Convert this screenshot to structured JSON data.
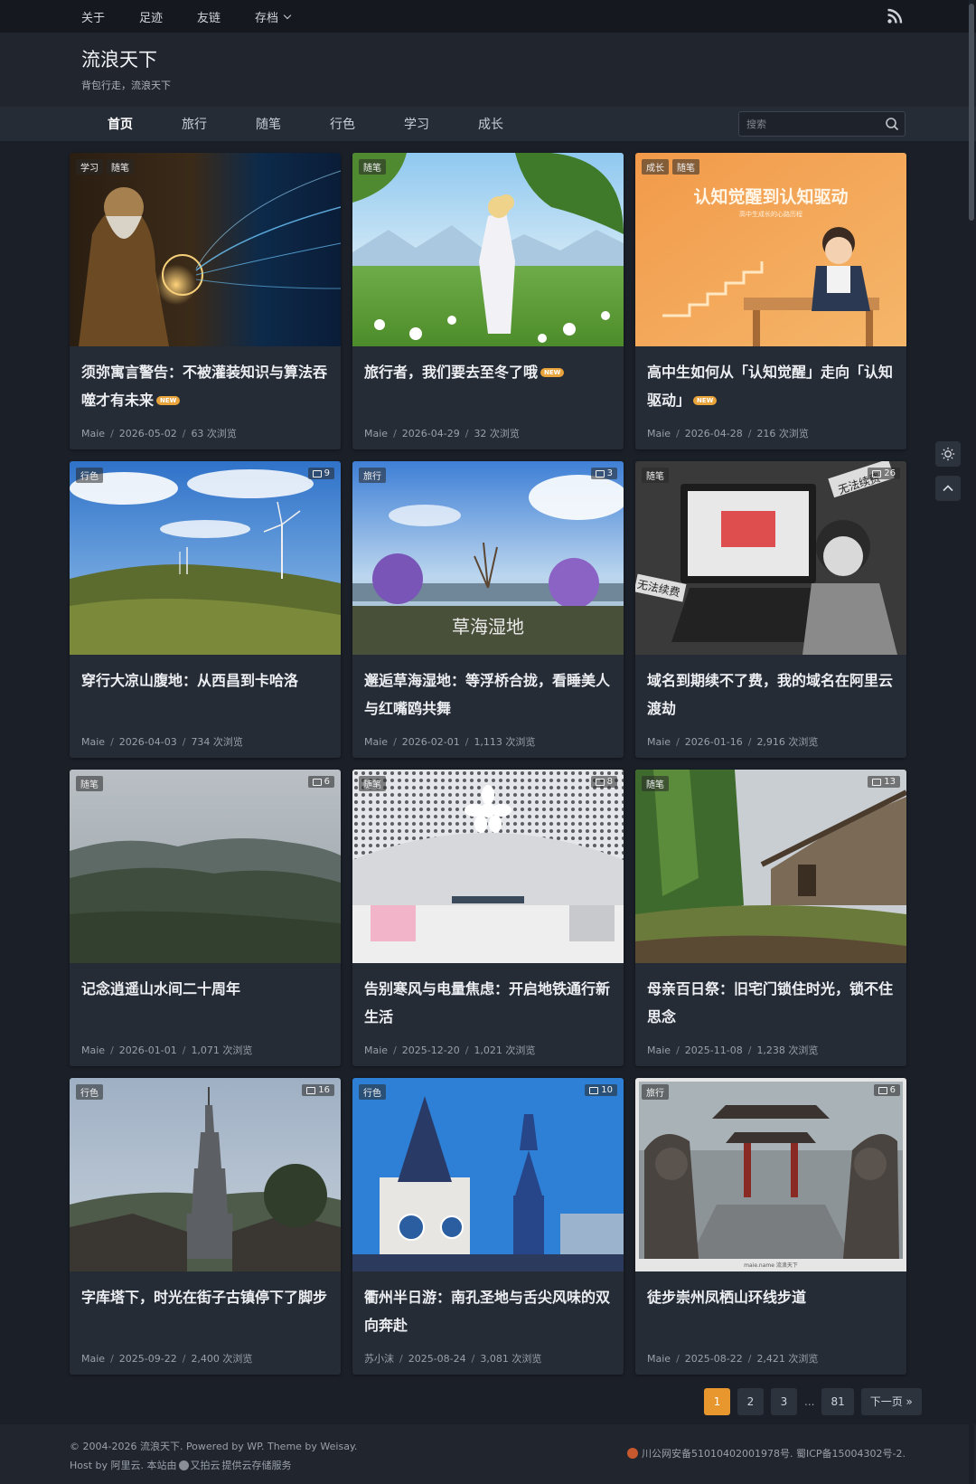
{
  "topnav": {
    "items": [
      "关于",
      "足迹",
      "友链",
      "存档"
    ],
    "rss_icon": "rss-icon"
  },
  "site": {
    "title": "流浪天下",
    "description": "背包行走，流浪天下"
  },
  "mainnav": {
    "items": [
      "首页",
      "旅行",
      "随笔",
      "行色",
      "学习",
      "成长"
    ],
    "active": "首页",
    "search_placeholder": "搜索"
  },
  "posts": [
    {
      "cats": [
        "学习",
        "随笔"
      ],
      "comments": "",
      "title": "须弥寓言警告：不被灌装知识与算法吞噬才有未来",
      "new": "NEW",
      "author": "Maie",
      "date": "2026-05-02",
      "views": "63 次浏览"
    },
    {
      "cats": [
        "随笔"
      ],
      "comments": "",
      "title": "旅行者，我们要去至冬了哦",
      "new": "NEW",
      "author": "Maie",
      "date": "2026-04-29",
      "views": "32 次浏览"
    },
    {
      "cats": [
        "成长",
        "随笔"
      ],
      "comments": "",
      "title": "高中生如何从「认知觉醒」走向「认知驱动」",
      "new": "NEW",
      "author": "Maie",
      "date": "2026-04-28",
      "views": "216 次浏览"
    },
    {
      "cats": [
        "行色"
      ],
      "comments": "9",
      "title": "穿行大凉山腹地：从西昌到卡哈洛",
      "new": "",
      "author": "Maie",
      "date": "2026-04-03",
      "views": "734 次浏览"
    },
    {
      "cats": [
        "旅行"
      ],
      "comments": "3",
      "title": "邂逅草海湿地：等浮桥合拢，看睡美人与红嘴鸥共舞",
      "new": "",
      "author": "Maie",
      "date": "2026-02-01",
      "views": "1,113 次浏览"
    },
    {
      "cats": [
        "随笔"
      ],
      "comments": "26",
      "title": "域名到期续不了费，我的域名在阿里云渡劫",
      "new": "",
      "author": "Maie",
      "date": "2026-01-16",
      "views": "2,916 次浏览"
    },
    {
      "cats": [
        "随笔"
      ],
      "comments": "6",
      "title": "记念逍遥山水间二十周年",
      "new": "",
      "author": "Maie",
      "date": "2026-01-01",
      "views": "1,071 次浏览"
    },
    {
      "cats": [
        "随笔"
      ],
      "comments": "8",
      "title": "告别寒风与电量焦虑：开启地铁通行新生活",
      "new": "",
      "author": "Maie",
      "date": "2025-12-20",
      "views": "1,021 次浏览"
    },
    {
      "cats": [
        "随笔"
      ],
      "comments": "13",
      "title": "母亲百日祭：旧宅门锁住时光，锁不住思念",
      "new": "",
      "author": "Maie",
      "date": "2025-11-08",
      "views": "1,238 次浏览"
    },
    {
      "cats": [
        "行色"
      ],
      "comments": "16",
      "title": "字库塔下，时光在街子古镇停下了脚步",
      "new": "",
      "author": "Maie",
      "date": "2025-09-22",
      "views": "2,400 次浏览"
    },
    {
      "cats": [
        "行色"
      ],
      "comments": "10",
      "title": "衢州半日游：南孔圣地与舌尖风味的双向奔赴",
      "new": "",
      "author": "苏小沫",
      "date": "2025-08-24",
      "views": "3,081 次浏览"
    },
    {
      "cats": [
        "旅行"
      ],
      "comments": "6",
      "title": "徒步崇州凤栖山环线步道",
      "new": "",
      "author": "Maie",
      "date": "2025-08-22",
      "views": "2,421 次浏览"
    }
  ],
  "image_text": {
    "card3_heading": "认知觉醒到认知驱动",
    "card3_sub": "高中生成长的心路历程",
    "card6_tag1": "无法续费",
    "card6_tag2": "无法续费",
    "card5_sign": "草海湿地",
    "card12_caption": "maie.name 流浪天下"
  },
  "pagination": {
    "pages": [
      "1",
      "2",
      "3",
      "81"
    ],
    "current": "1",
    "ellipsis": "...",
    "next": "下一页 »"
  },
  "footer": {
    "copyright": "© 2004-2026 流浪天下. Powered by WP. Theme by Weisay.",
    "host_prefix": "Host by 阿里云. 本站由",
    "host_brand": "又拍云",
    "host_suffix": "提供云存储服务",
    "icp": "川公网安备51010402001978号. 蜀ICP备15004302号-2."
  },
  "colors": {
    "background": "#1b1f27",
    "card": "#262c36",
    "accent": "#e8962e"
  }
}
